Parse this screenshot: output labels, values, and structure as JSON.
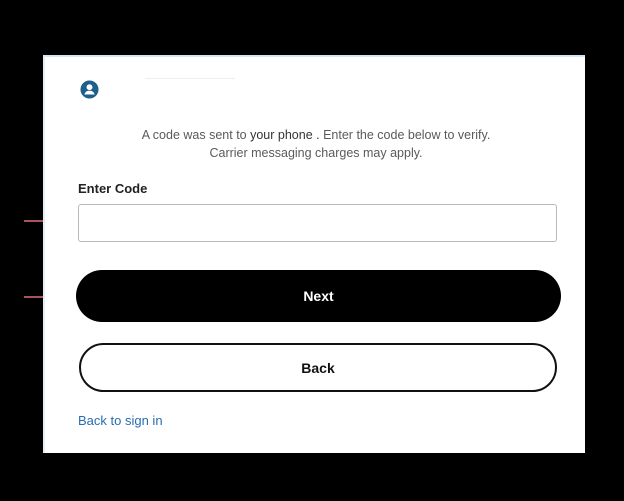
{
  "message": {
    "line1_prefix": "A code was sent to",
    "line1_emphasis": "your phone .",
    "line1_suffix": "Enter the code below to verify.",
    "line2": "Carrier messaging charges may apply."
  },
  "code_field": {
    "label": "Enter Code",
    "value": "",
    "placeholder": ""
  },
  "buttons": {
    "next_label": "Next",
    "back_label": "Back"
  },
  "links": {
    "back_to_signin": "Back to sign in"
  },
  "colors": {
    "accent": "#2b6cb0",
    "user_icon": "#1f5f8b",
    "annotation_arrow": "#e07080",
    "primary_button": "#000000"
  },
  "icons": {
    "user": "user-circle-icon",
    "annotation": "arrow-right-icon"
  }
}
